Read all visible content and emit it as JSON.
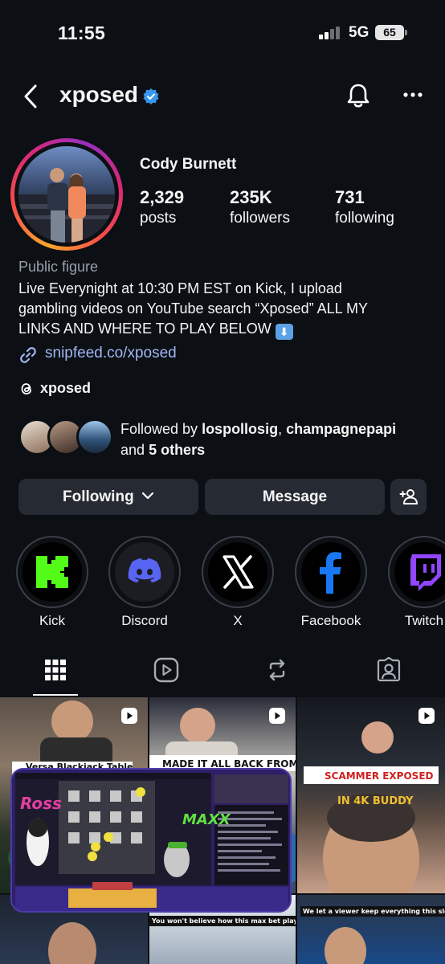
{
  "status_bar": {
    "time": "11:55",
    "network": "5G",
    "battery": "65"
  },
  "header": {
    "username": "xposed"
  },
  "profile": {
    "name": "Cody Burnett",
    "stats": [
      {
        "value": "2,329",
        "label": "posts"
      },
      {
        "value": "235K",
        "label": "followers"
      },
      {
        "value": "731",
        "label": "following"
      }
    ],
    "category": "Public figure",
    "bio_line1": "Live Everynight at 10:30 PM EST on Kick, I upload",
    "bio_line2": "gambling videos on YouTube search “Xposed” ALL MY",
    "bio_line3": "LINKS AND WHERE TO PLAY BELOW",
    "link": "snipfeed.co/xposed",
    "threads": "xposed"
  },
  "followed_by": {
    "prefix": "Followed by",
    "user1": "lospollosig",
    "user2": "champagnepapi",
    "and": "and",
    "others": "5 others"
  },
  "actions": {
    "following": "Following",
    "message": "Message"
  },
  "highlights": [
    {
      "label": "Kick",
      "color": "#53fc18"
    },
    {
      "label": "Discord",
      "color": "#5865f2"
    },
    {
      "label": "X",
      "color": "#ffffff"
    },
    {
      "label": "Facebook",
      "color": "#1877f2"
    },
    {
      "label": "Twitch",
      "color": "#9146ff"
    }
  ],
  "grid": {
    "captions": {
      "c1": "Versa Blackjack Table",
      "c2": "MADE IT ALL BACK FROM ONE",
      "c3": "SCAMMER EXPOSED",
      "c3b": "IN 4K BUDDY",
      "c5": "You won't believe how this max bet played out!",
      "c6": "We let a viewer keep everything this slot p"
    },
    "pip_texts": {
      "ross": "Ross",
      "maxx": "MAXX"
    }
  }
}
